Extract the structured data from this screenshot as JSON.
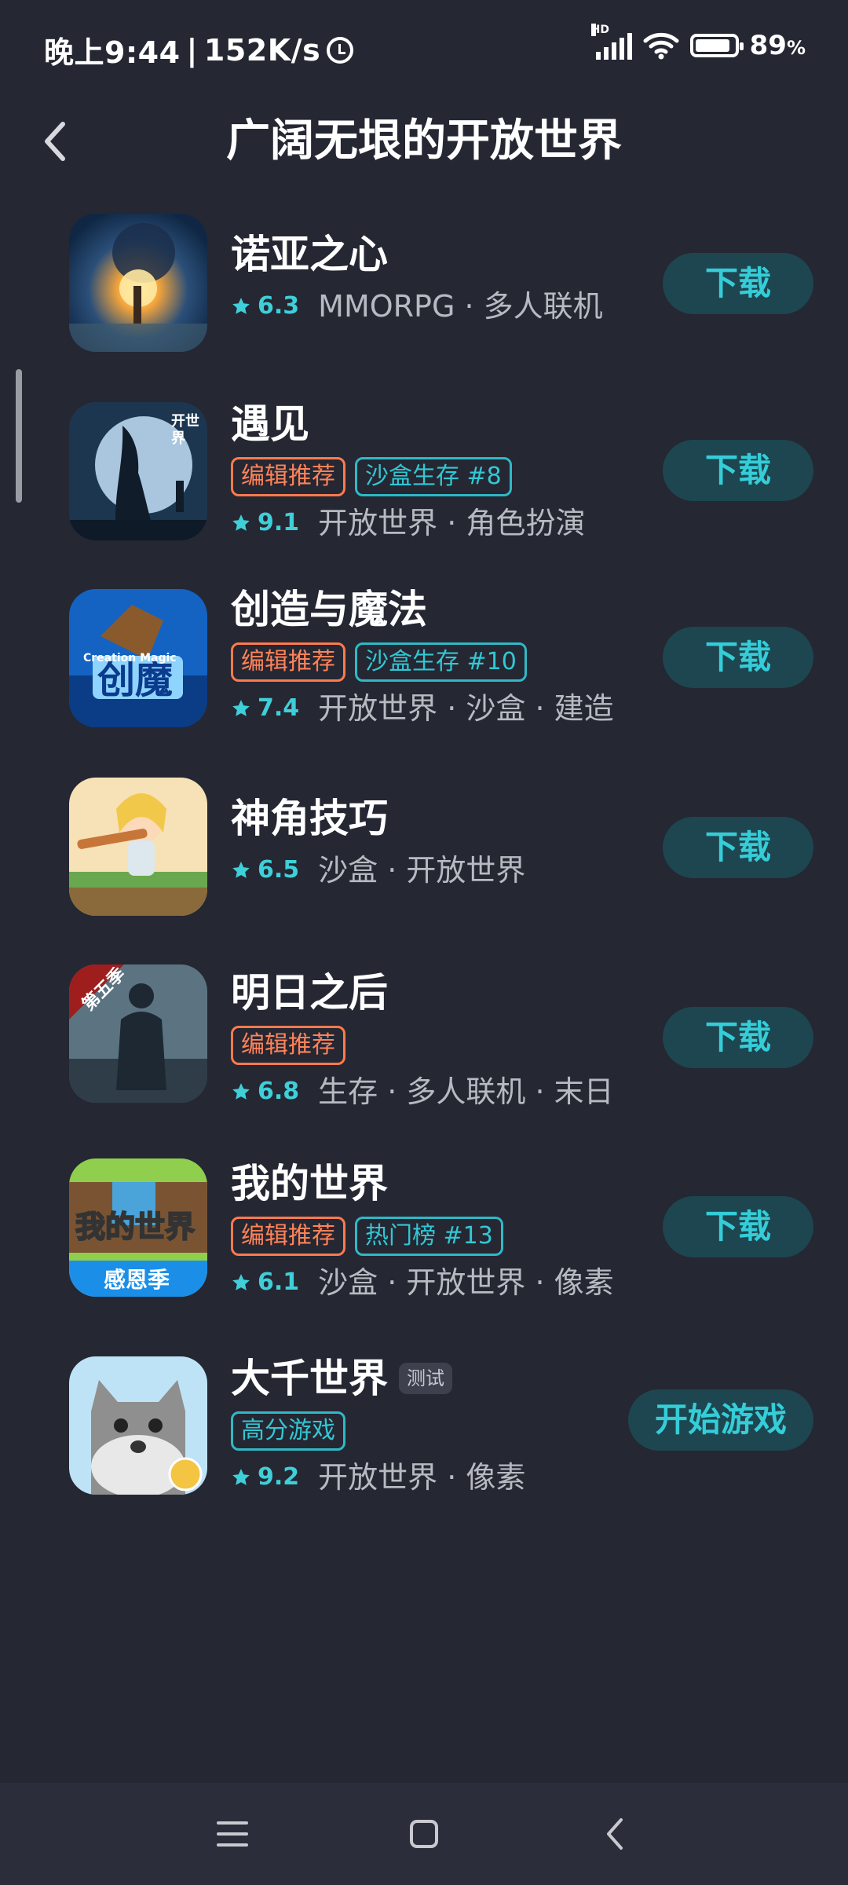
{
  "status": {
    "time": "晚上9:44",
    "speed": "152K/s",
    "separator": "|",
    "network": "HD",
    "battery_pct": "89",
    "battery_unit": "%"
  },
  "header": {
    "title": "广阔无垠的开放世界"
  },
  "colors": {
    "accent": "#34cdd8",
    "tag_orange": "#ff7a4d",
    "background": "#252733"
  },
  "apps": [
    {
      "name": "诺亚之心",
      "badge": "",
      "tags": [],
      "rating": "6.3",
      "genres": "MMORPG · 多人联机",
      "button": "下载"
    },
    {
      "name": "遇见",
      "badge": "",
      "tags": [
        {
          "text": "编辑推荐",
          "style": "orange"
        },
        {
          "text": "沙盒生存 #8",
          "style": "teal"
        }
      ],
      "rating": "9.1",
      "genres": "开放世界 · 角色扮演",
      "button": "下载"
    },
    {
      "name": "创造与魔法",
      "badge": "",
      "tags": [
        {
          "text": "编辑推荐",
          "style": "orange"
        },
        {
          "text": "沙盒生存 #10",
          "style": "teal"
        }
      ],
      "rating": "7.4",
      "genres": "开放世界 · 沙盒 · 建造",
      "button": "下载"
    },
    {
      "name": "神角技巧",
      "badge": "",
      "tags": [],
      "rating": "6.5",
      "genres": "沙盒 · 开放世界",
      "button": "下载"
    },
    {
      "name": "明日之后",
      "badge": "",
      "tags": [
        {
          "text": "编辑推荐",
          "style": "orange"
        }
      ],
      "rating": "6.8",
      "genres": "生存 · 多人联机 · 末日",
      "button": "下载"
    },
    {
      "name": "我的世界",
      "badge": "",
      "tags": [
        {
          "text": "编辑推荐",
          "style": "orange"
        },
        {
          "text": "热门榜 #13",
          "style": "teal"
        }
      ],
      "rating": "6.1",
      "genres": "沙盒 · 开放世界 · 像素",
      "button": "下载"
    },
    {
      "name": "大千世界",
      "badge": "测试",
      "tags": [
        {
          "text": "高分游戏",
          "style": "teal"
        }
      ],
      "rating": "9.2",
      "genres": "开放世界 · 像素",
      "button": "开始游戏"
    }
  ],
  "icon_text": {
    "yujian": "开世\n界",
    "chuangzao": "创魔",
    "chuangzao_sub": "Creation Magic",
    "mingri": "第五季",
    "minecraft": "我的世界",
    "minecraft_sub": "感恩季"
  },
  "icons": [
    "back-icon",
    "star-icon",
    "menu-icon",
    "home-icon",
    "nav-back-icon"
  ]
}
